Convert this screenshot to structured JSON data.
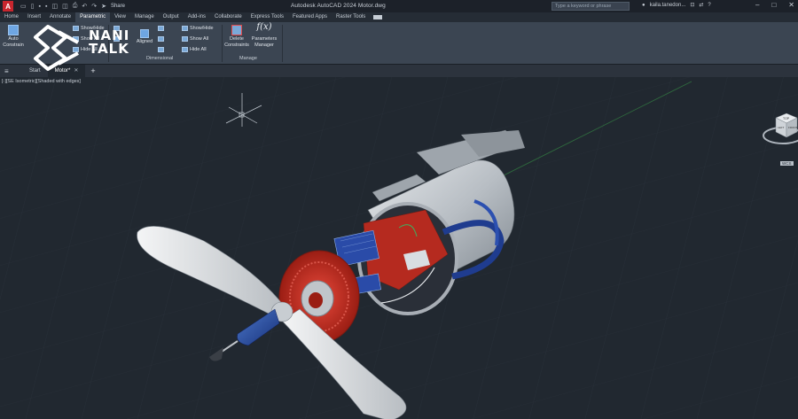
{
  "app": {
    "icon": "A",
    "window_title": "Autodesk AutoCAD 2024   Motor.dwg",
    "share_label": "Share",
    "search_placeholder": "Type a keyword or phrase",
    "user_name": "kaila.tanedon..."
  },
  "ribbon_tabs": [
    "Home",
    "Insert",
    "Annotate",
    "Parametric",
    "View",
    "Manage",
    "Output",
    "Add-ins",
    "Collaborate",
    "Express Tools",
    "Featured Apps",
    "Raster Tools"
  ],
  "active_ribbon_tab": "Parametric",
  "ribbon": {
    "auto_constrain": "Auto\nConstrain",
    "show_hide_1": "Show/Hide",
    "show_all_1": "Show All",
    "hide_all_1": "Hide All",
    "aligned": "Aligned",
    "show_hide_2": "Show/Hide",
    "show_all_2": "Show All",
    "hide_all_2": "Hide All",
    "dimensional_panel": "Dimensional",
    "delete_constraints": "Delete\nConstraints",
    "parameters_manager": "Parameters\nManager",
    "manage_panel": "Manage",
    "fx": "f(x)"
  },
  "file_tabs": [
    {
      "label": "Start"
    },
    {
      "label": "Motor*"
    }
  ],
  "viewport": {
    "label": "[-][SE Isometric][Shaded with edges]",
    "viewcube_top": "TOP",
    "viewcube_left": "LEFT",
    "viewcube_front": "FRONT",
    "ucs_label": "WCS"
  },
  "watermark": {
    "line1": "NANI",
    "line2": "TALK"
  },
  "colors": {
    "app_red": "#c8262e",
    "accent_blue": "#6ea6e3",
    "motor_red": "#c42a1f",
    "motor_blue": "#1f3c8f",
    "metal_silver": "#c0c5ca",
    "viewport_bg": "#212830"
  }
}
